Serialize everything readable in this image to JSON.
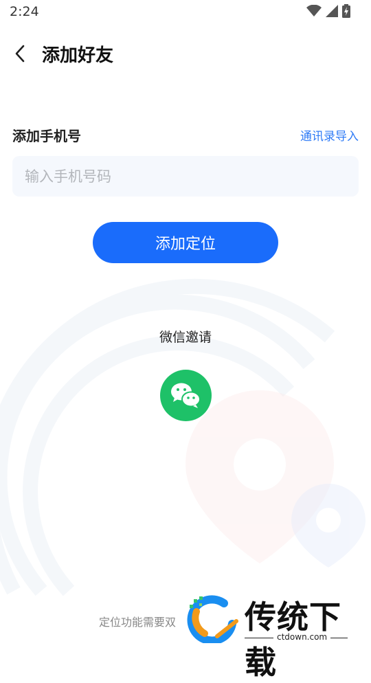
{
  "status_bar": {
    "time": "2:24",
    "icons": [
      "wifi-icon",
      "cellular-signal-icon",
      "battery-charging-icon"
    ]
  },
  "header": {
    "back_icon": "chevron-left-icon",
    "title": "添加好友"
  },
  "phone_section": {
    "label": "添加手机号",
    "import_link": "通讯录导入",
    "input_placeholder": "输入手机号码",
    "input_value": ""
  },
  "add_button": {
    "label": "添加定位"
  },
  "wechat_invite": {
    "label": "微信邀请",
    "icon": "wechat-icon"
  },
  "footer": {
    "note": "定位功能需要双"
  },
  "watermark": {
    "brand": "传统下载",
    "url": "ctdown.com"
  },
  "colors": {
    "accent": "#1a6cfb",
    "link": "#2f7bf6",
    "wechat": "#1ec168",
    "input_bg": "#f5f8fd"
  }
}
